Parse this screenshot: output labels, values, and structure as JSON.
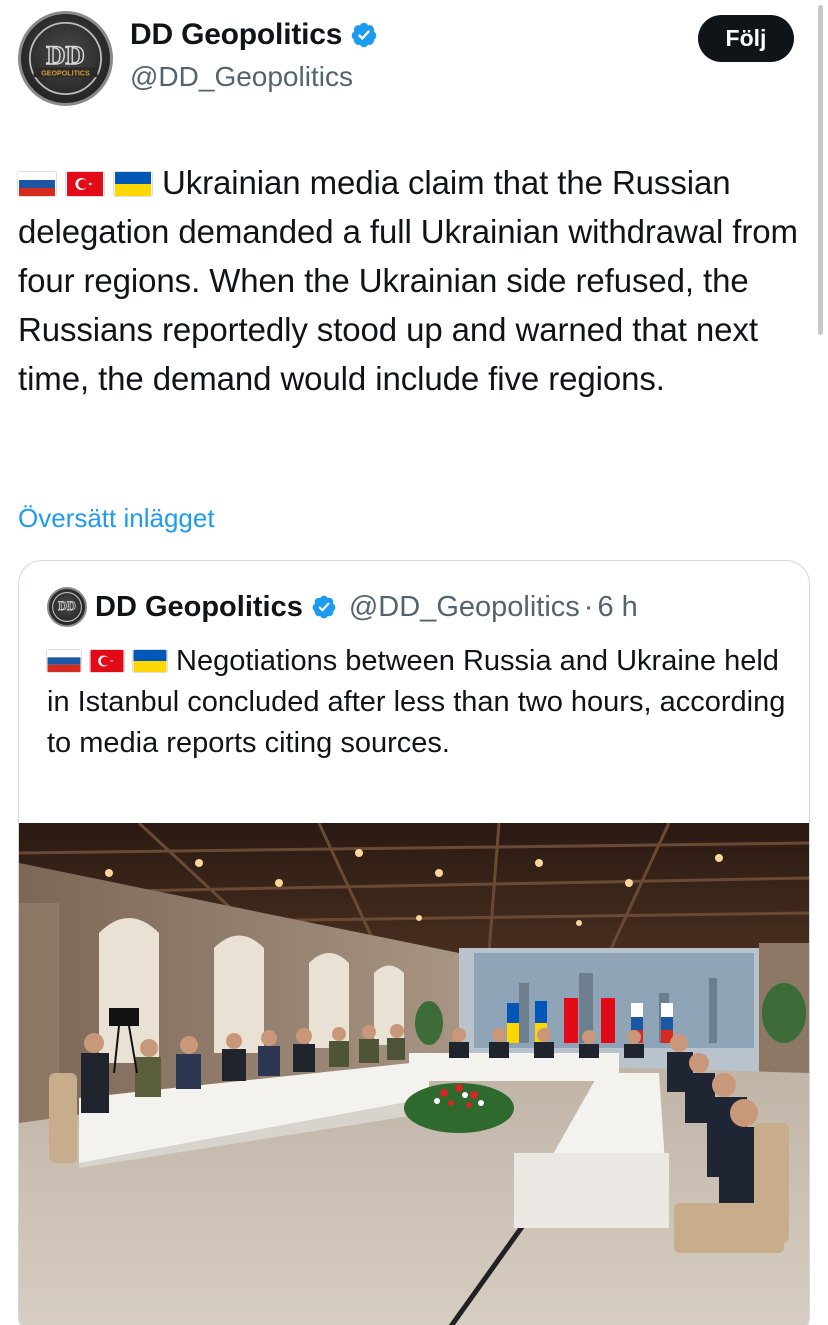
{
  "author": {
    "name": "DD Geopolitics",
    "handle": "@DD_Geopolitics",
    "avatar_text": "DD",
    "avatar_subtext": "GEOPOLITICS",
    "verified": true
  },
  "follow_label": "Följ",
  "tweet": {
    "flags": [
      "russia-flag",
      "turkey-flag",
      "ukraine-flag"
    ],
    "text": "Ukrainian media claim that the Russian delegation demanded a full Ukrainian withdrawal from four regions. When the Ukrainian side refused, the Russians reportedly stood up and warned that next time, the demand would include five regions."
  },
  "translate_label": "Översätt inlägget",
  "quote": {
    "name": "DD Geopolitics",
    "handle": "@DD_Geopolitics",
    "separator": "·",
    "time": "6 h",
    "flags": [
      "russia-flag",
      "turkey-flag",
      "ukraine-flag"
    ],
    "text": "Negotiations between Russia and Ukraine held in Istanbul concluded after less than two hours, according to media reports citing sources.",
    "image_icon": "meeting-room-photo"
  },
  "colors": {
    "accent": "#1d9bf0",
    "text": "#0f1419",
    "secondary": "#536471",
    "follow_bg": "#0f1419",
    "border": "#cfd9de"
  }
}
